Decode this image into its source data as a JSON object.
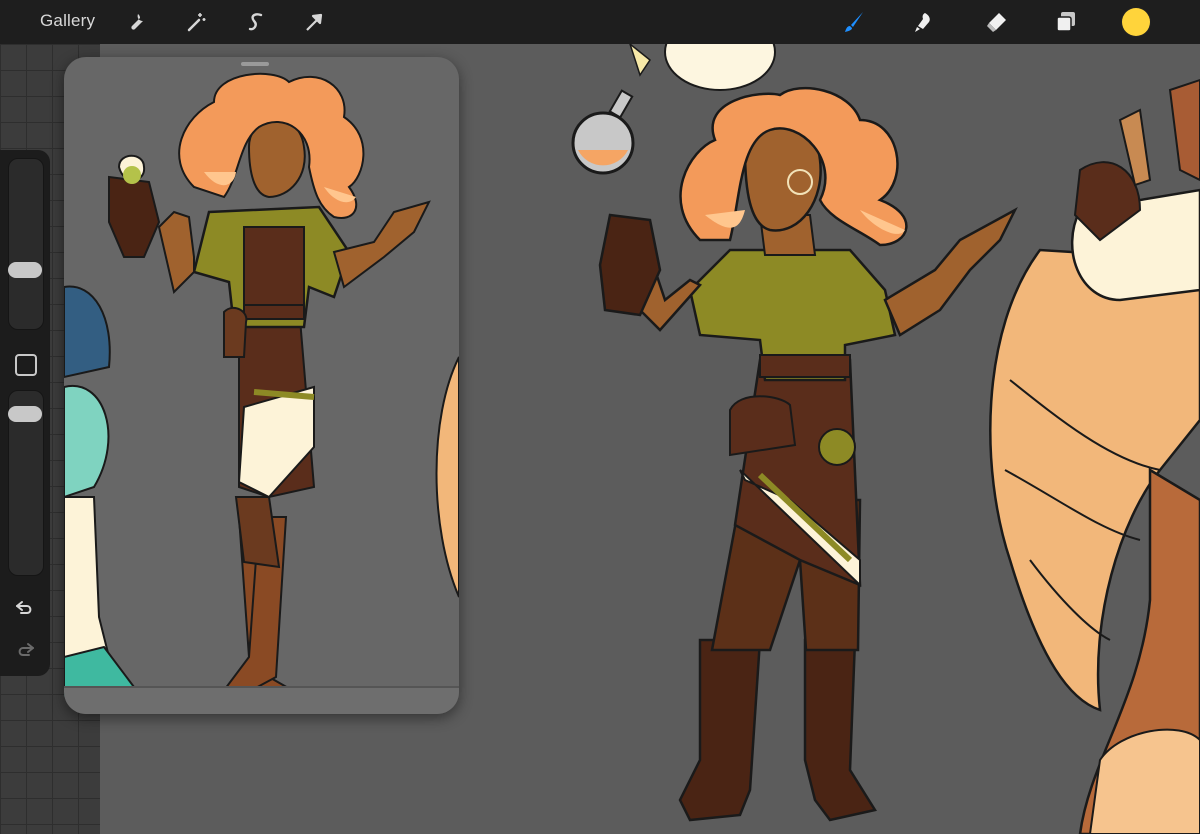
{
  "app": {
    "gallery_label": "Gallery"
  },
  "toolbar": {
    "left_tools": [
      "wrench-icon",
      "magic-wand-icon",
      "selection-s-icon",
      "transform-arrow-icon"
    ],
    "right_tools": [
      "brush-icon",
      "smudge-icon",
      "eraser-icon",
      "layers-icon"
    ],
    "brush_active_color": "#1e8fff",
    "current_color": "#ffd43b"
  },
  "sidebar": {
    "tools": [
      "brush-size-slider",
      "modify-button",
      "opacity-slider",
      "undo-icon",
      "redo-icon"
    ]
  },
  "colors": {
    "canvas_bg": "#5c5c5c",
    "hair": "#f39a5a",
    "hair_light": "#ffc68e",
    "skin": "#a0622e",
    "shirt": "#8d8a25",
    "leather": "#5a2d1b",
    "cream": "#fdf3d8",
    "wing": "#f2b77a"
  }
}
